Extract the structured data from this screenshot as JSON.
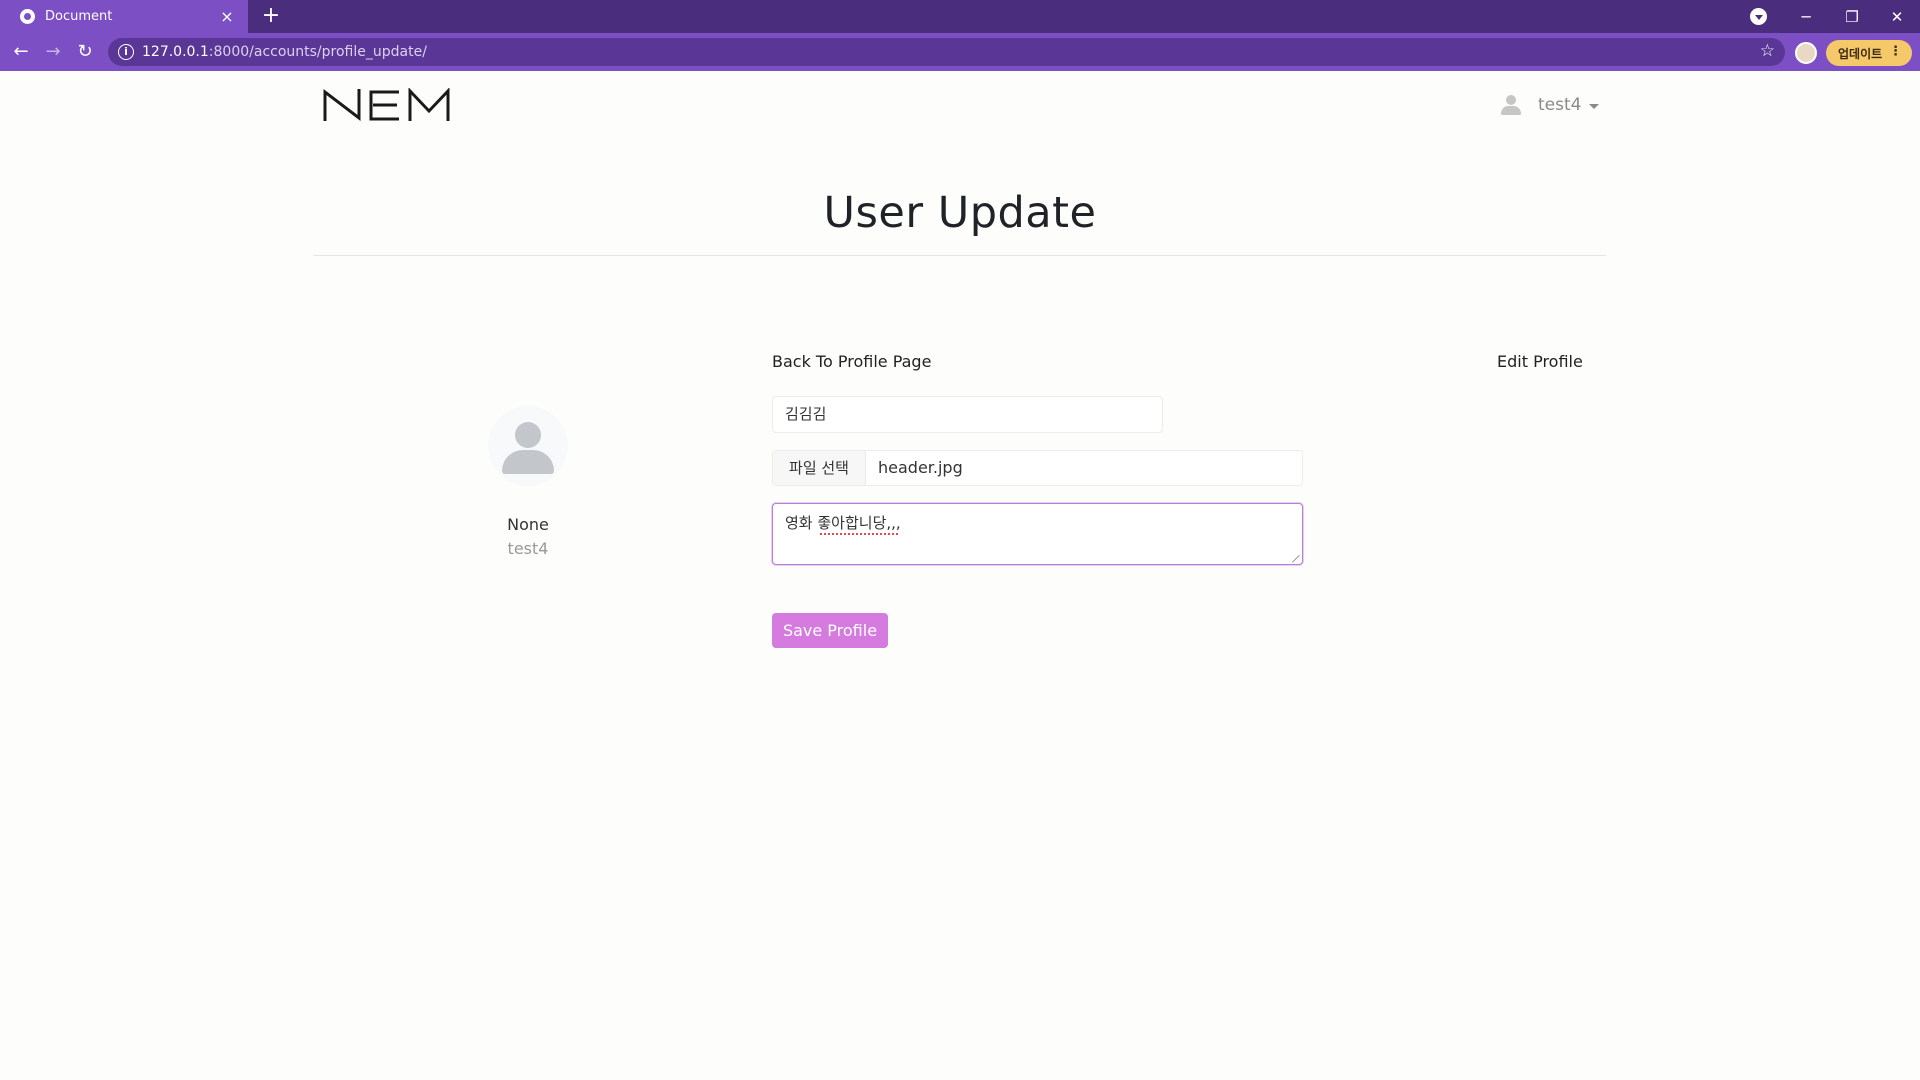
{
  "browser": {
    "tab_title": "Document",
    "tab_close": "×",
    "new_tab": "+",
    "url_host": "127.0.0.1",
    "url_rest": ":8000/accounts/profile_update/",
    "update_label": "업데이트",
    "update_menu": "⋮",
    "back": "←",
    "forward": "→",
    "reload": "↻",
    "star": "☆",
    "minimize": "─",
    "restore": "❐",
    "close": "✕",
    "accent": "#7d4fc4"
  },
  "header": {
    "username": "test4"
  },
  "page": {
    "title": "User Update"
  },
  "sidebar": {
    "name": "None",
    "username": "test4"
  },
  "links": {
    "back": "Back To Profile Page",
    "edit": "Edit Profile"
  },
  "form": {
    "name_value": "김김김",
    "file_button": "파일 선택",
    "file_name": "header.jpg",
    "bio_value": "영화 좋아합니당,,,",
    "save_label": "Save Profile",
    "save_color": "#d57be0"
  }
}
